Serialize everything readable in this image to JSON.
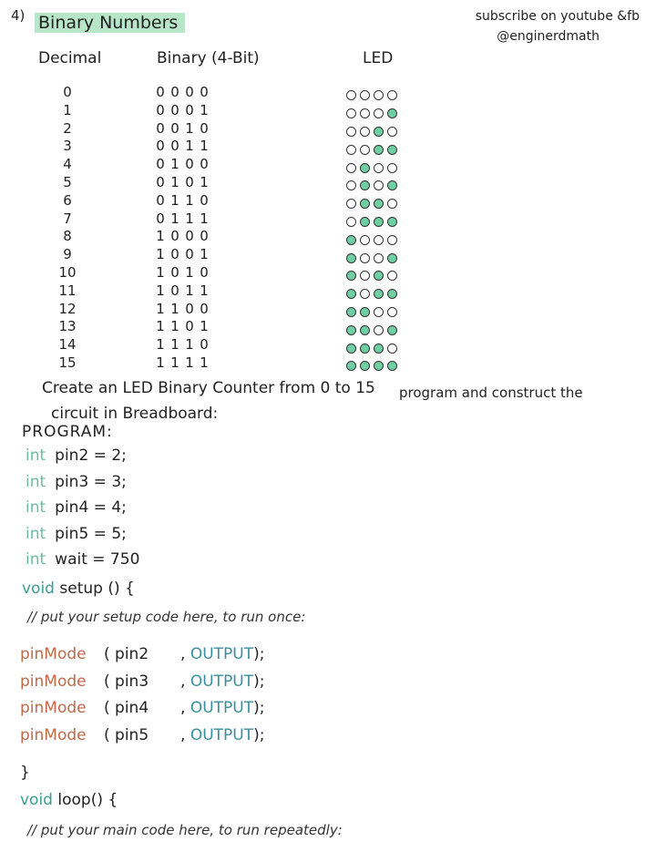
{
  "header": {
    "question_number": "4)",
    "title": "Binary Numbers",
    "social_line1": "subscribe on youtube &fb",
    "social_line2": "@enginerdmath"
  },
  "table": {
    "col_decimal": "Decimal",
    "col_binary": "Binary (4-Bit)",
    "col_led": "LED",
    "rows": [
      {
        "dec": "0",
        "bits": [
          "0",
          "0",
          "0",
          "0"
        ],
        "leds": [
          false,
          false,
          false,
          false
        ]
      },
      {
        "dec": "1",
        "bits": [
          "0",
          "0",
          "0",
          "1"
        ],
        "leds": [
          false,
          false,
          false,
          true
        ]
      },
      {
        "dec": "2",
        "bits": [
          "0",
          "0",
          "1",
          "0"
        ],
        "leds": [
          false,
          false,
          true,
          false
        ]
      },
      {
        "dec": "3",
        "bits": [
          "0",
          "0",
          "1",
          "1"
        ],
        "leds": [
          false,
          false,
          true,
          true
        ]
      },
      {
        "dec": "4",
        "bits": [
          "0",
          "1",
          "0",
          "0"
        ],
        "leds": [
          false,
          true,
          false,
          false
        ]
      },
      {
        "dec": "5",
        "bits": [
          "0",
          "1",
          "0",
          "1"
        ],
        "leds": [
          false,
          true,
          false,
          true
        ]
      },
      {
        "dec": "6",
        "bits": [
          "0",
          "1",
          "1",
          "0"
        ],
        "leds": [
          false,
          true,
          true,
          false
        ]
      },
      {
        "dec": "7",
        "bits": [
          "0",
          "1",
          "1",
          "1"
        ],
        "leds": [
          false,
          true,
          true,
          true
        ]
      },
      {
        "dec": "8",
        "bits": [
          "1",
          "0",
          "0",
          "0"
        ],
        "leds": [
          true,
          false,
          false,
          false
        ]
      },
      {
        "dec": "9",
        "bits": [
          "1",
          "0",
          "0",
          "1"
        ],
        "leds": [
          true,
          false,
          false,
          true
        ]
      },
      {
        "dec": "10",
        "bits": [
          "1",
          "0",
          "1",
          "0"
        ],
        "leds": [
          true,
          false,
          true,
          false
        ]
      },
      {
        "dec": "11",
        "bits": [
          "1",
          "0",
          "1",
          "1"
        ],
        "leds": [
          true,
          false,
          true,
          true
        ]
      },
      {
        "dec": "12",
        "bits": [
          "1",
          "1",
          "0",
          "0"
        ],
        "leds": [
          true,
          true,
          false,
          false
        ]
      },
      {
        "dec": "13",
        "bits": [
          "1",
          "1",
          "0",
          "1"
        ],
        "leds": [
          true,
          true,
          false,
          true
        ]
      },
      {
        "dec": "14",
        "bits": [
          "1",
          "1",
          "1",
          "0"
        ],
        "leds": [
          true,
          true,
          true,
          false
        ]
      },
      {
        "dec": "15",
        "bits": [
          "1",
          "1",
          "1",
          "1"
        ],
        "leds": [
          true,
          true,
          true,
          true
        ]
      }
    ],
    "led_on_color": "#6fcfa2"
  },
  "instruction": {
    "line1_a": "Create an LED Binary Counter from 0 to 15",
    "line1_b": "program and construct the",
    "line2": "circuit in Breadboard:"
  },
  "program": {
    "label": "PROGRAM:",
    "decls": [
      {
        "kw": "int",
        "rest": "pin2 = 2;"
      },
      {
        "kw": "int",
        "rest": "pin3 = 3;"
      },
      {
        "kw": "int",
        "rest": "pin4 = 4;"
      },
      {
        "kw": "int",
        "rest": "pin5 = 5;"
      },
      {
        "kw": "int",
        "rest": "wait = 750"
      }
    ],
    "setup_kw": "void",
    "setup_sig": "setup () {",
    "setup_comment": "// put your setup code here, to run once:",
    "pinmodes": [
      {
        "fn": "pinMode",
        "arg": "( pin2",
        "mode": "OUTPUT",
        "end": ");"
      },
      {
        "fn": "pinMode",
        "arg": "( pin3",
        "mode": "OUTPUT",
        "end": ");"
      },
      {
        "fn": "pinMode",
        "arg": "( pin4",
        "mode": "OUTPUT",
        "end": ");"
      },
      {
        "fn": "pinMode",
        "arg": "( pin5",
        "mode": "OUTPUT",
        "end": ");"
      }
    ],
    "close_brace": "}",
    "loop_kw": "void",
    "loop_sig": "loop() {",
    "loop_comment": "// put your main code here, to run repeatedly:"
  },
  "colors": {
    "title_highlight": "#b8e6c8",
    "keyword_int": "#6cbda0",
    "keyword_void": "#3a9e92",
    "function_pinmode": "#c06a4a",
    "constant_output": "#3a8f9e"
  }
}
